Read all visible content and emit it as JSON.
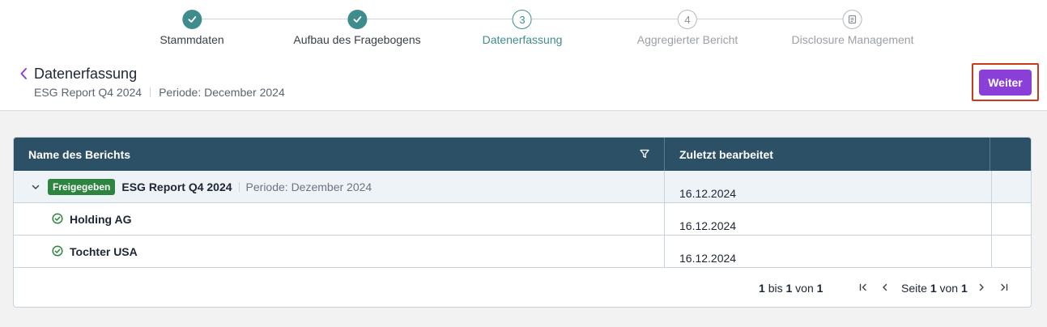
{
  "stepper": {
    "steps": [
      {
        "label": "Stammdaten",
        "marker": "",
        "state": "done"
      },
      {
        "label": "Aufbau des Fragebogens",
        "marker": "",
        "state": "done"
      },
      {
        "label": "Datenerfassung",
        "marker": "3",
        "state": "active"
      },
      {
        "label": "Aggregierter Bericht",
        "marker": "4",
        "state": "todo"
      },
      {
        "label": "Disclosure Management",
        "marker": "",
        "state": "todo"
      }
    ],
    "done_icon": "check-icon",
    "last_icon": "document-icon"
  },
  "page": {
    "title": "Datenerfassung",
    "report_name": "ESG Report Q4 2024",
    "period": "Periode: December 2024",
    "back_icon": "chevron-left-icon"
  },
  "actions": {
    "next_label": "Weiter"
  },
  "table": {
    "columns": [
      "Name des Berichts",
      "Zuletzt bearbeitet"
    ],
    "filter_icon": "filter-icon",
    "group": {
      "badge": "Freigegeben",
      "name": "ESG Report Q4 2024",
      "period": "Periode: Dezember 2024",
      "date": "16.12.2024"
    },
    "rows": [
      {
        "name": "Holding AG",
        "date": "16.12.2024",
        "icon": "check-circle-icon"
      },
      {
        "name": "Tochter USA",
        "date": "16.12.2024",
        "icon": "check-circle-icon"
      }
    ]
  },
  "pagination": {
    "from": "1",
    "to_word": "bis",
    "to": "1",
    "of_word": "von",
    "total": "1",
    "page_word": "Seite",
    "page": "1",
    "page_of_word": "von",
    "pages": "1"
  },
  "colors": {
    "accent": "#8b3fd9",
    "step_teal": "#3f8c8c",
    "header_bg": "#2c5166",
    "badge_green": "#2e8540",
    "highlight": "#c8391f"
  }
}
